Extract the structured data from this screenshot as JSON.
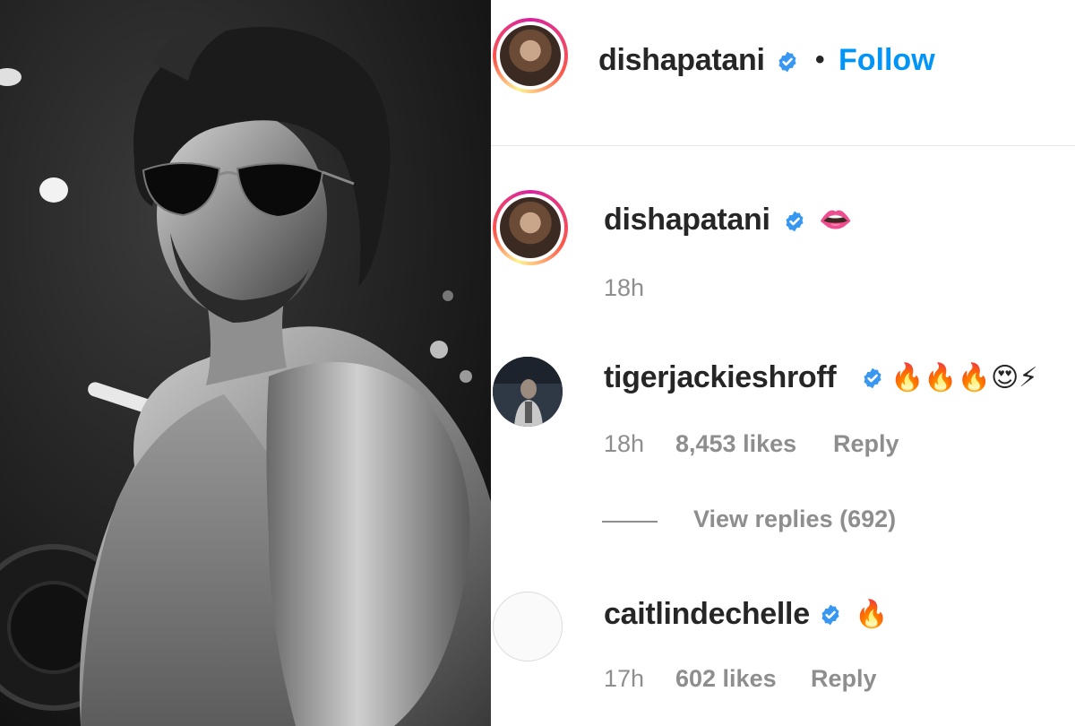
{
  "post_author": {
    "username": "dishapatani",
    "separator": "•",
    "follow_label": "Follow"
  },
  "comments": [
    {
      "username": "dishapatani",
      "text": "👄",
      "time": "18h"
    },
    {
      "username": "tigerjackieshroff",
      "text": "🔥🔥🔥😍⚡",
      "time": "18h",
      "likes": "8,453 likes",
      "reply_label": "Reply",
      "view_replies": "View replies (692)"
    },
    {
      "username": "caitlindechelle",
      "text": "🔥",
      "time": "17h",
      "likes": "602 likes",
      "reply_label": "Reply"
    }
  ],
  "colors": {
    "follow_blue": "#0095f6",
    "verified_blue": "#3897f0",
    "meta_gray": "#8e8e8e",
    "text_dark": "#262626"
  },
  "icons": [
    "verified-badge-icon",
    "avatar"
  ]
}
